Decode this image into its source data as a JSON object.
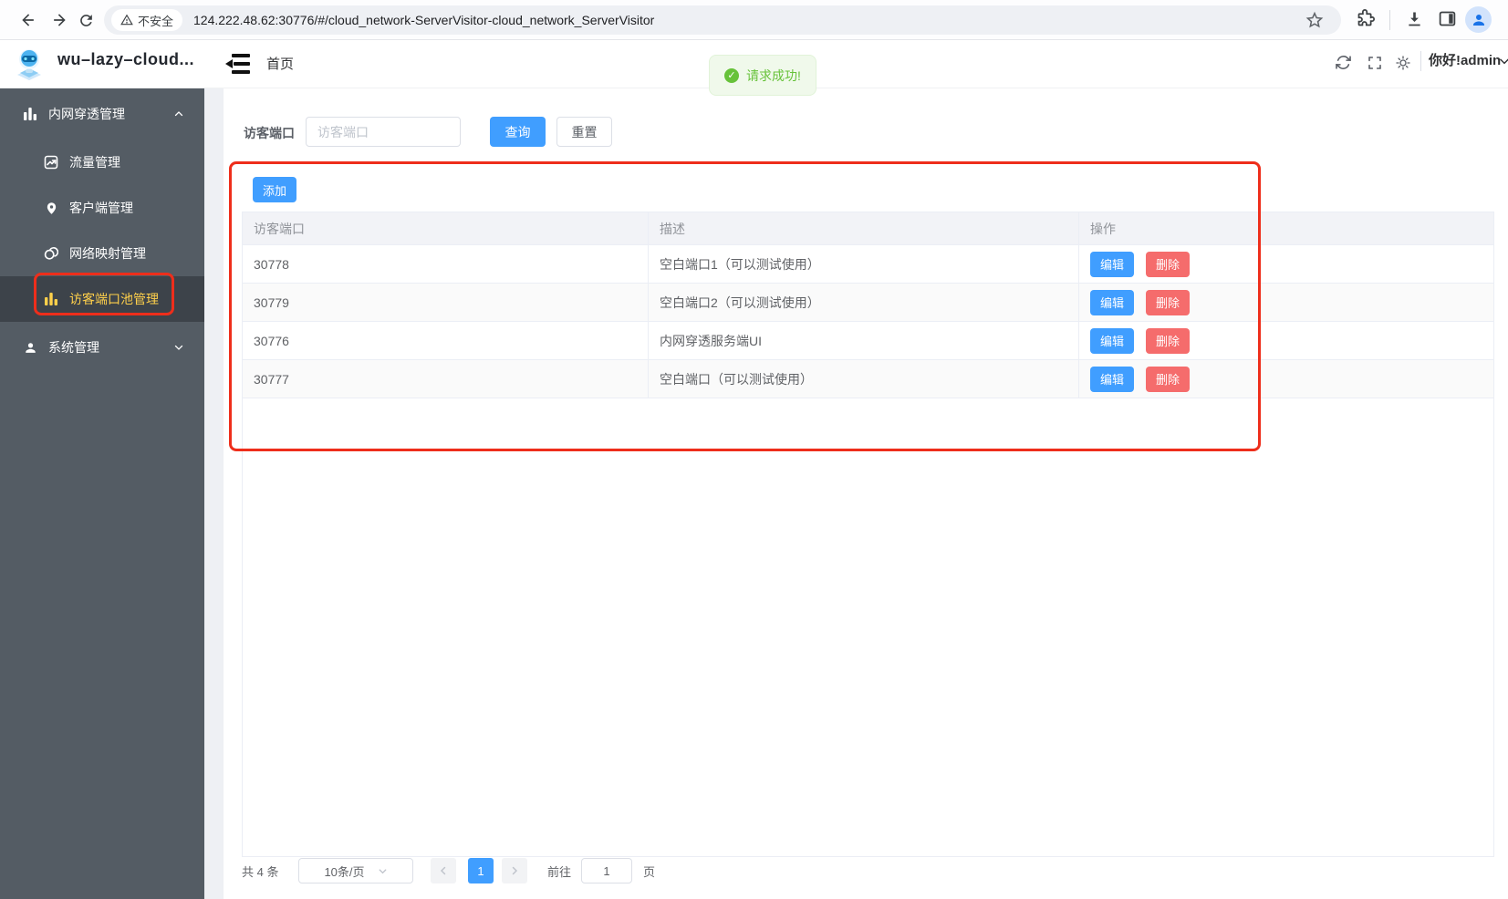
{
  "browser": {
    "security_label": "不安全",
    "url": "124.222.48.62:30776/#/cloud_network-ServerVisitor-cloud_network_ServerVisitor"
  },
  "header": {
    "app_title": "wu–lazy–cloud...",
    "breadcrumb_home": "首页",
    "greeting": "你好!admin"
  },
  "toast": {
    "message": "请求成功!"
  },
  "sidebar": {
    "group1": {
      "label": "内网穿透管理"
    },
    "group1_items": [
      {
        "label": "流量管理"
      },
      {
        "label": "客户端管理"
      },
      {
        "label": "网络映射管理"
      },
      {
        "label": "访客端口池管理"
      }
    ],
    "group2": {
      "label": "系统管理"
    }
  },
  "search": {
    "label": "访客端口",
    "placeholder": "访客端口",
    "query_button": "查询",
    "reset_button": "重置"
  },
  "toolbar": {
    "add_button": "添加"
  },
  "table": {
    "columns": {
      "port": "访客端口",
      "desc": "描述",
      "actions": "操作"
    },
    "rows": [
      {
        "port": "30778",
        "desc": "空白端口1（可以测试使用）"
      },
      {
        "port": "30779",
        "desc": "空白端口2（可以测试使用）"
      },
      {
        "port": "30776",
        "desc": "内网穿透服务端UI"
      },
      {
        "port": "30777",
        "desc": "空白端口（可以测试使用）"
      }
    ],
    "edit_button": "编辑",
    "delete_button": "删除"
  },
  "pagination": {
    "total": "共 4 条",
    "page_size": "10条/页",
    "current_page": "1",
    "goto_label": "前往",
    "goto_value": "1",
    "page_suffix": "页"
  },
  "icons": [
    "back-icon",
    "forward-icon",
    "reload-icon",
    "warning-icon",
    "star-icon",
    "extensions-icon",
    "download-icon",
    "side-panel-icon",
    "profile-icon",
    "app-logo",
    "menu-fold-icon",
    "refresh-icon",
    "fullscreen-icon",
    "theme-sun-icon",
    "chevron-down-icon",
    "chevron-up-icon",
    "bar-chart-icon",
    "traffic-chart-icon",
    "location-pin-icon",
    "link-map-icon",
    "user-icon",
    "check-circle-icon",
    "chevron-left-icon",
    "chevron-right-icon"
  ],
  "colors": {
    "primary": "#409eff",
    "danger": "#f56c6c",
    "success": "#67c23a",
    "sidebar_bg": "#545c64",
    "sidebar_active_text": "#ffd04b",
    "annotation": "#ee2e1b"
  }
}
